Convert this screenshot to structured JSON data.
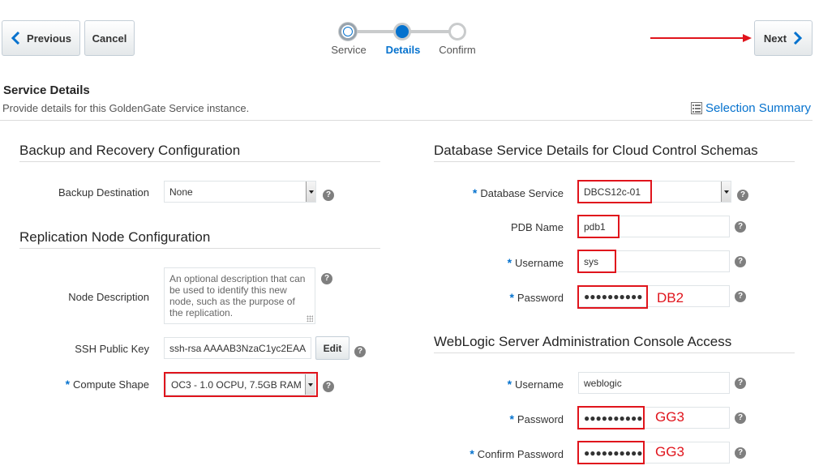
{
  "nav": {
    "previous_label": "Previous",
    "cancel_label": "Cancel",
    "next_label": "Next"
  },
  "train": {
    "steps": [
      {
        "label": "Service",
        "state": "visited"
      },
      {
        "label": "Details",
        "state": "current"
      },
      {
        "label": "Confirm",
        "state": "future"
      }
    ]
  },
  "header": {
    "title": "Service Details",
    "description": "Provide details for this GoldenGate Service instance.",
    "selection_summary": "Selection Summary"
  },
  "backup": {
    "section_title": "Backup and Recovery Configuration",
    "destination_label": "Backup Destination",
    "destination_value": "None"
  },
  "replication": {
    "section_title": "Replication Node Configuration",
    "description_label": "Node Description",
    "description_placeholder": "An optional description that can be used to identify this new node, such as the purpose of the replication.",
    "ssh_label": "SSH Public Key",
    "ssh_value": "ssh-rsa AAAAB3NzaC1yc2EAA",
    "edit_label": "Edit",
    "compute_label": "Compute Shape",
    "compute_value": "OC3 - 1.0 OCPU, 7.5GB RAM"
  },
  "database": {
    "section_title": "Database Service Details for Cloud Control Schemas",
    "service_label": "Database Service",
    "service_value": "DBCS12c-01",
    "pdb_label": "PDB Name",
    "pdb_value": "pdb1",
    "username_label": "Username",
    "username_value": "sys",
    "password_label": "Password",
    "password_value": "●●●●●●●●●●",
    "password_annotation": "DB2"
  },
  "weblogic": {
    "section_title": "WebLogic Server Administration Console Access",
    "username_label": "Username",
    "username_value": "weblogic",
    "password_label": "Password",
    "password_value": "●●●●●●●●●●",
    "password_annotation": "GG3",
    "confirm_label": "Confirm Password",
    "confirm_value": "●●●●●●●●●●",
    "confirm_annotation": "GG3"
  },
  "required_marker": "*",
  "help_glyph": "?",
  "colors": {
    "accent": "#0572ce",
    "annotation": "#e0141c"
  }
}
